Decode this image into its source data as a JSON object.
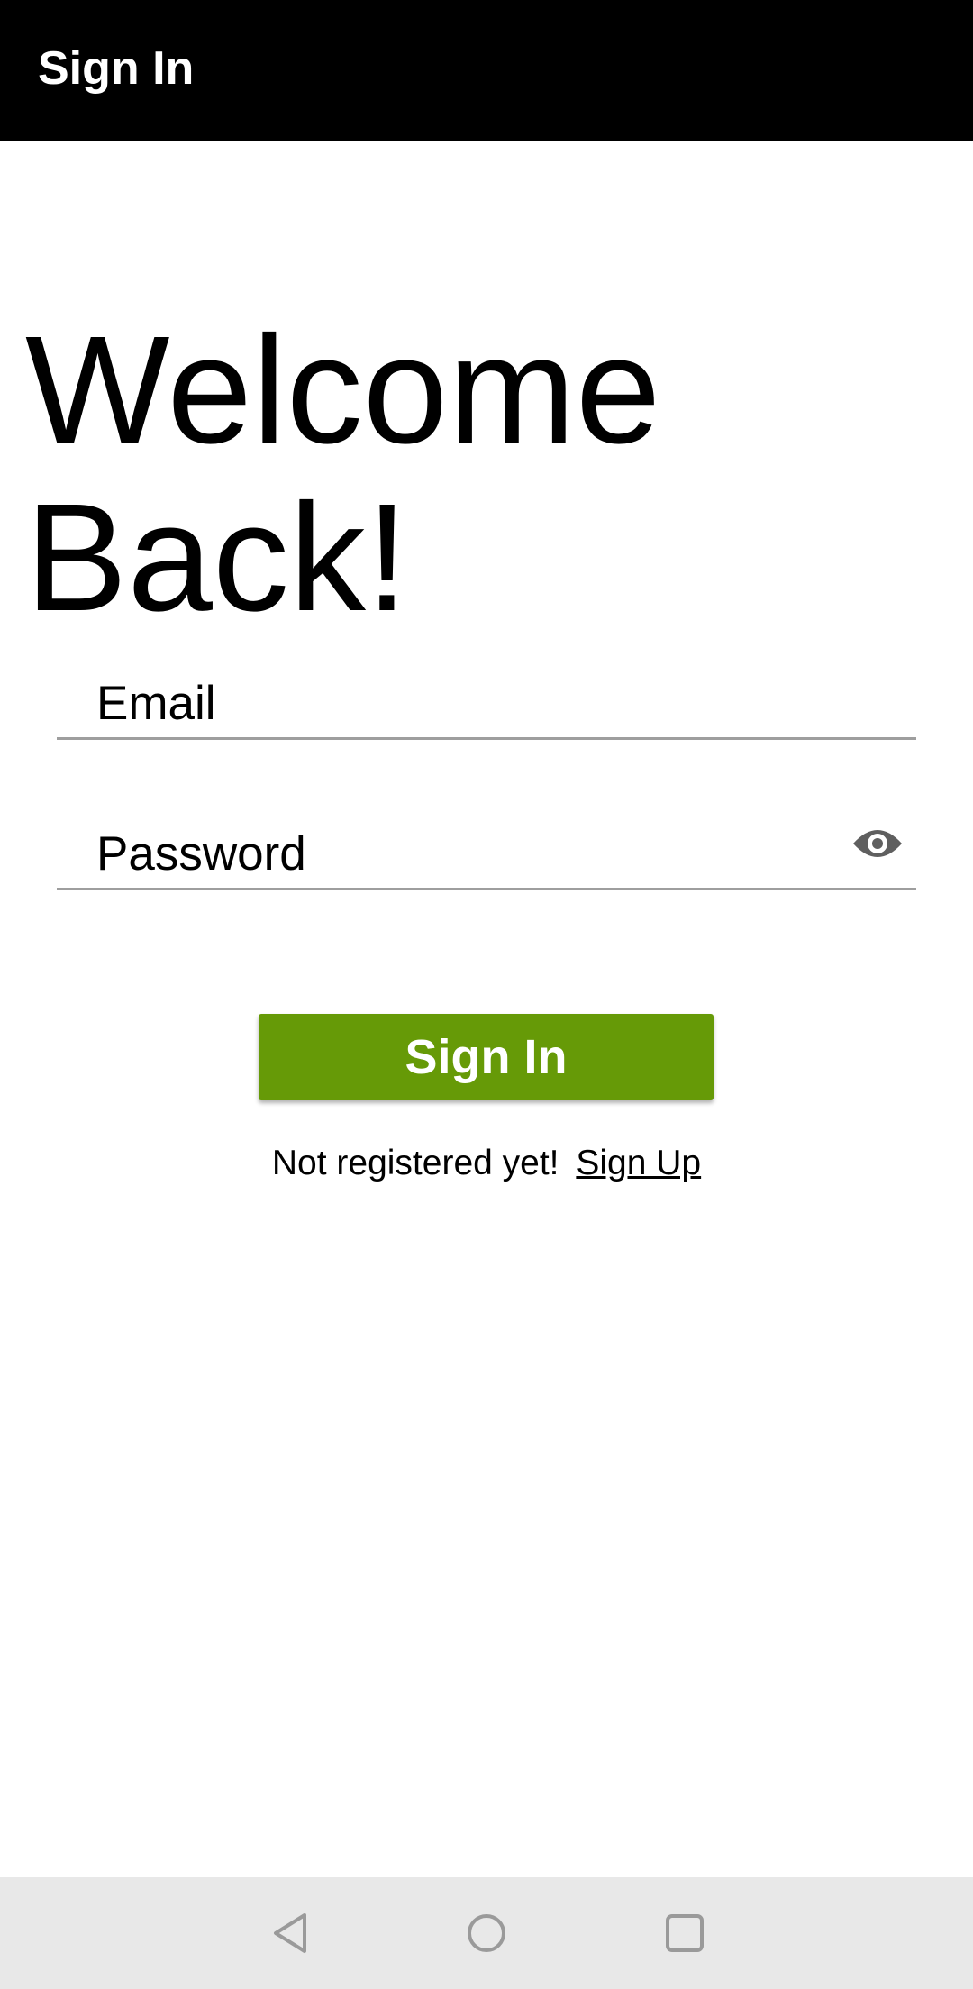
{
  "app_bar": {
    "title": "Sign In"
  },
  "heading": {
    "text": "Welcome Back!"
  },
  "form": {
    "email": {
      "placeholder": "Email",
      "value": ""
    },
    "password": {
      "placeholder": "Password",
      "value": "",
      "toggle_icon": "eye-icon"
    },
    "submit_label": "Sign In"
  },
  "signup": {
    "prompt": "Not registered yet!",
    "link_label": "Sign Up"
  },
  "nav_bar": {
    "back_icon": "back-triangle-icon",
    "home_icon": "home-circle-icon",
    "recents_icon": "recents-square-icon"
  },
  "colors": {
    "app_bar_bg": "#000000",
    "button_bg": "#669a07",
    "nav_bar_bg": "#e8e8e8",
    "underline": "#9e9e9e"
  }
}
